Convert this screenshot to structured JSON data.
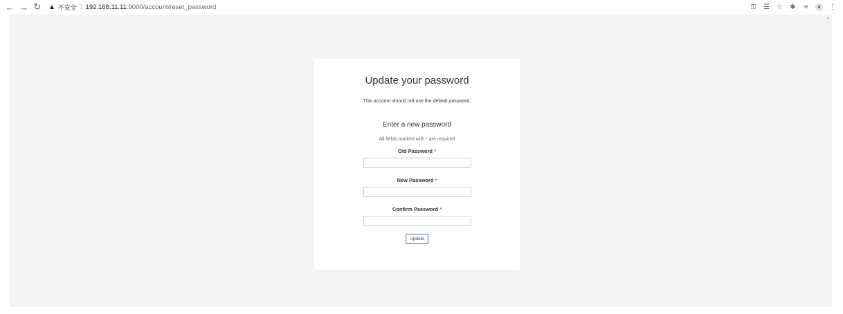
{
  "browser": {
    "back_icon": "back-arrow-icon",
    "forward_icon": "forward-arrow-icon",
    "reload_icon": "reload-icon",
    "security_label": "不安全",
    "url_host": "192.168.11.11",
    "url_path": ":9000/account/reset_password",
    "right_icons": [
      "key-icon",
      "translate-icon",
      "star-icon",
      "extensions-icon",
      "reading-list-icon",
      "profile-icon",
      "menu-icon"
    ]
  },
  "card": {
    "title": "Update your password",
    "note": "This account should not use the default password.",
    "subheading": "Enter a new password",
    "required_prefix": "All fields marked with ",
    "required_star": "*",
    "required_suffix": " are required",
    "fields": [
      {
        "label": "Old Password",
        "value": ""
      },
      {
        "label": "New Password",
        "value": ""
      },
      {
        "label": "Confirm Password",
        "value": ""
      }
    ],
    "required_marker": "*",
    "submit_label": "Update"
  }
}
